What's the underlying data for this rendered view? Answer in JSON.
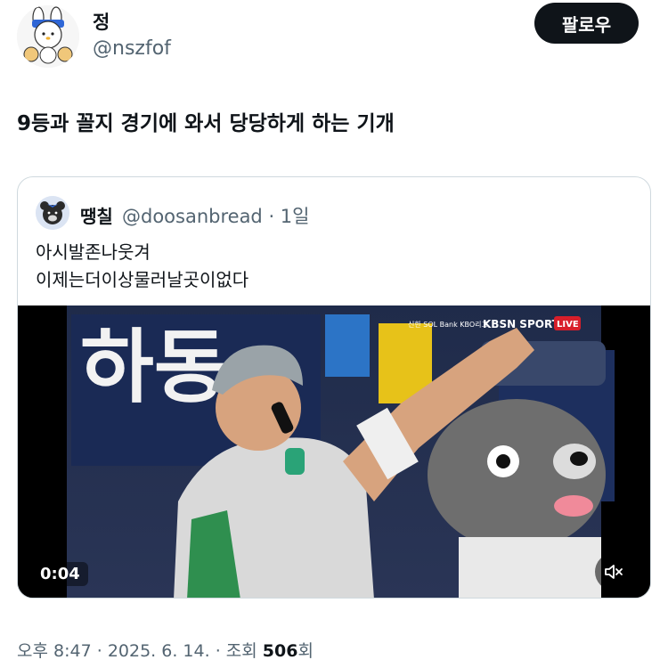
{
  "user": {
    "display_name": "정",
    "handle": "@nszfof",
    "follow_label": "팔로우",
    "avatar_icon": "bunny-character-avatar"
  },
  "tweet": {
    "text": "9등과 꼴지 경기에 와서 당당하게 하는 기개"
  },
  "quote": {
    "name": "땡칠",
    "handle_time": "@doosanbread · 1일",
    "avatar_icon": "bear-mascot-avatar",
    "line1": "아시발존나웃겨",
    "line2": "이제는더이상물러날곳이없다",
    "video": {
      "duration": "0:04",
      "overlay_logo": "KBSN SPORTS",
      "overlay_sub": "신한 SOL Bank KBO리그",
      "overlay_live": "LIVE",
      "mute_icon": "speaker-muted-icon"
    }
  },
  "meta": {
    "time": "오후 8:47",
    "date": "2025. 6. 14.",
    "views_label": "조회",
    "views_count": "506",
    "views_suffix": "회"
  },
  "colors": {
    "text_primary": "#0f1419",
    "text_secondary": "#536471",
    "border": "#cfd9de",
    "button_bg": "#0f1419"
  }
}
